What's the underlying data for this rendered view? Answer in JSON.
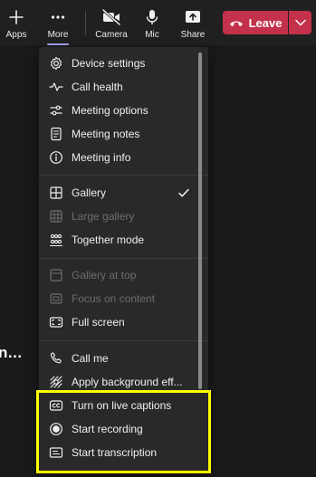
{
  "toolbar": {
    "apps_label": "Apps",
    "more_label": "More",
    "camera_label": "Camera",
    "mic_label": "Mic",
    "share_label": "Share",
    "leave_label": "Leave"
  },
  "background": {
    "name_fragment": "n..."
  },
  "menu": {
    "items": [
      {
        "label": "Device settings",
        "icon": "gear-icon",
        "disabled": false
      },
      {
        "label": "Call health",
        "icon": "pulse-icon",
        "disabled": false
      },
      {
        "label": "Meeting options",
        "icon": "sliders-icon",
        "disabled": false
      },
      {
        "label": "Meeting notes",
        "icon": "notes-icon",
        "disabled": false
      },
      {
        "label": "Meeting info",
        "icon": "info-icon",
        "disabled": false
      },
      {
        "label": "Gallery",
        "icon": "grid-icon",
        "disabled": false,
        "checked": true
      },
      {
        "label": "Large gallery",
        "icon": "large-grid-icon",
        "disabled": true
      },
      {
        "label": "Together mode",
        "icon": "people-icon",
        "disabled": false
      },
      {
        "label": "Gallery at top",
        "icon": "gallery-top-icon",
        "disabled": true
      },
      {
        "label": "Focus on content",
        "icon": "focus-icon",
        "disabled": true
      },
      {
        "label": "Full screen",
        "icon": "fullscreen-icon",
        "disabled": false
      },
      {
        "label": "Call me",
        "icon": "phone-icon",
        "disabled": false
      },
      {
        "label": "Apply background eff...",
        "icon": "background-effects-icon",
        "disabled": false
      },
      {
        "label": "Turn on live captions",
        "icon": "captions-icon",
        "disabled": false
      },
      {
        "label": "Start recording",
        "icon": "record-icon",
        "disabled": false
      },
      {
        "label": "Start transcription",
        "icon": "transcript-icon",
        "disabled": false
      }
    ]
  },
  "colors": {
    "leave": "#c4314b",
    "highlight": "#ffff00",
    "menu_bg": "#292929",
    "accent_underline": "#a8a8f5"
  }
}
